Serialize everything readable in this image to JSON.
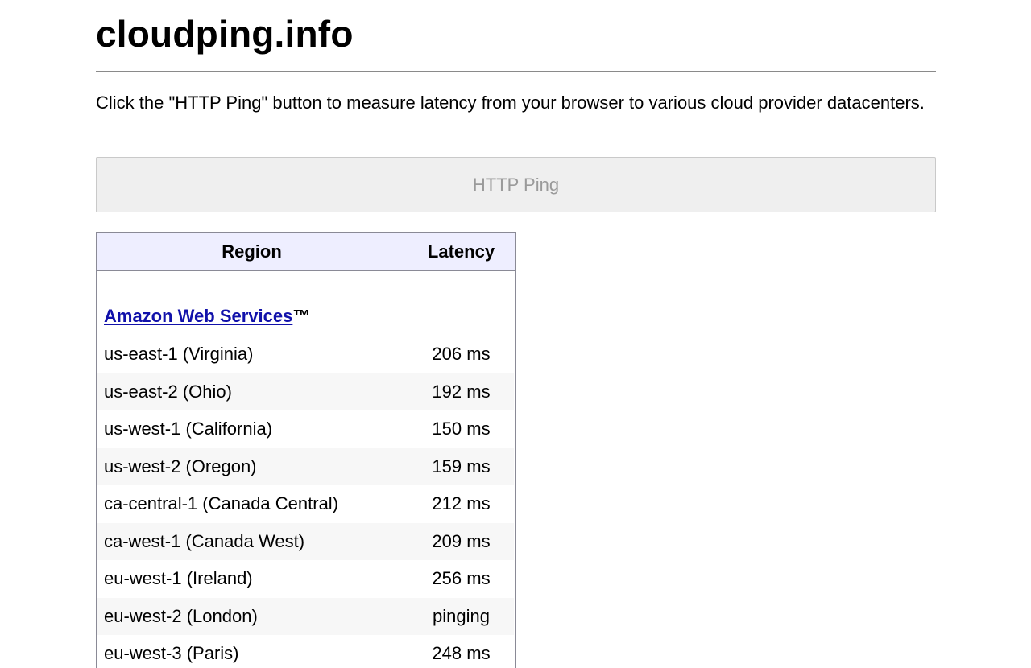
{
  "header": {
    "site_title": "cloudping.info"
  },
  "intro": {
    "text": "Click the \"HTTP Ping\" button to measure latency from your browser to various cloud provider datacenters."
  },
  "ping_button": {
    "label": "HTTP Ping"
  },
  "table": {
    "columns": {
      "region": "Region",
      "latency": "Latency"
    },
    "provider": {
      "name": "Amazon Web Services",
      "suffix": "™"
    },
    "rows": [
      {
        "region": "us-east-1 (Virginia)",
        "latency": "206 ms"
      },
      {
        "region": "us-east-2 (Ohio)",
        "latency": "192 ms"
      },
      {
        "region": "us-west-1 (California)",
        "latency": "150 ms"
      },
      {
        "region": "us-west-2 (Oregon)",
        "latency": "159 ms"
      },
      {
        "region": "ca-central-1 (Canada Central)",
        "latency": "212 ms"
      },
      {
        "region": "ca-west-1 (Canada West)",
        "latency": "209 ms"
      },
      {
        "region": "eu-west-1 (Ireland)",
        "latency": "256 ms"
      },
      {
        "region": "eu-west-2 (London)",
        "latency": "pinging"
      },
      {
        "region": "eu-west-3 (Paris)",
        "latency": "248 ms"
      }
    ]
  }
}
